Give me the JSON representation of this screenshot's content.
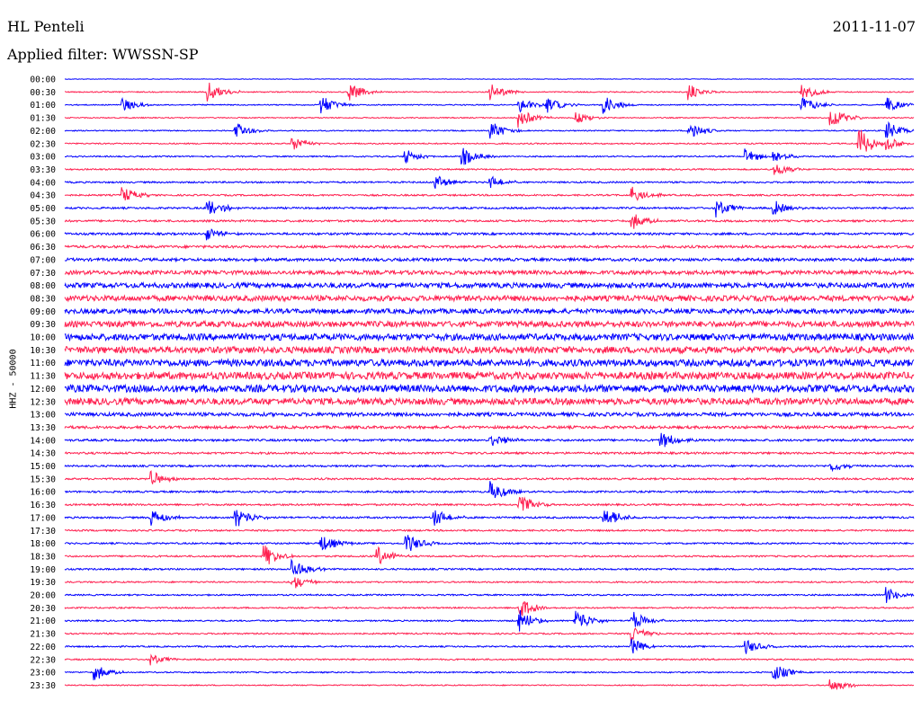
{
  "header": {
    "station": "HL Penteli",
    "date": "2011-11-07",
    "filter_label": "Applied filter:",
    "filter_value": "WWSSN-SP"
  },
  "chart_data": {
    "type": "line",
    "ylabel": "HHZ - 50000",
    "colors": [
      "#0000ff",
      "#ff1f4f"
    ],
    "rows": [
      "00:00",
      "00:30",
      "01:00",
      "01:30",
      "02:00",
      "02:30",
      "03:00",
      "03:30",
      "04:00",
      "04:30",
      "05:00",
      "05:30",
      "06:00",
      "06:30",
      "07:00",
      "07:30",
      "08:00",
      "08:30",
      "09:00",
      "09:30",
      "10:00",
      "10:30",
      "11:00",
      "11:30",
      "12:00",
      "12:30",
      "13:00",
      "13:30",
      "14:00",
      "14:30",
      "15:00",
      "15:30",
      "16:00",
      "16:30",
      "17:00",
      "17:30",
      "18:00",
      "18:30",
      "19:00",
      "19:30",
      "20:00",
      "20:30",
      "21:00",
      "21:30",
      "22:00",
      "22:30",
      "23:00",
      "23:30"
    ],
    "noise_level": [
      0.3,
      0.6,
      0.6,
      0.6,
      0.6,
      0.7,
      0.7,
      0.8,
      0.9,
      0.9,
      1.0,
      1.1,
      1.2,
      1.4,
      1.6,
      2.2,
      2.8,
      3.0,
      2.6,
      3.2,
      3.6,
      3.6,
      3.8,
      4.0,
      4.0,
      3.6,
      2.0,
      1.5,
      1.2,
      1.1,
      1.0,
      1.0,
      1.0,
      1.0,
      1.0,
      0.9,
      0.9,
      0.9,
      0.9,
      0.8,
      0.8,
      0.8,
      0.8,
      0.8,
      0.8,
      0.8,
      0.7,
      0.6
    ],
    "events": [
      {
        "row": 1,
        "minute": 5,
        "amp": 14
      },
      {
        "row": 2,
        "minute": 2,
        "amp": 8
      },
      {
        "row": 2,
        "minute": 17,
        "amp": 10
      },
      {
        "row": 2,
        "minute": 9,
        "amp": 12
      },
      {
        "row": 4,
        "minute": 15,
        "amp": 12
      },
      {
        "row": 1,
        "minute": 15,
        "amp": 10
      },
      {
        "row": 2,
        "minute": 16,
        "amp": 10
      },
      {
        "row": 3,
        "minute": 16,
        "amp": 12
      },
      {
        "row": 6,
        "minute": 12,
        "amp": 10
      },
      {
        "row": 3,
        "minute": 27,
        "amp": 14
      },
      {
        "row": 5,
        "minute": 28,
        "amp": 12
      },
      {
        "row": 6,
        "minute": 14,
        "amp": 12
      },
      {
        "row": 9,
        "minute": 20,
        "amp": 10
      },
      {
        "row": 3,
        "minute": 18,
        "amp": 8
      },
      {
        "row": 2,
        "minute": 29,
        "amp": 10
      },
      {
        "row": 6,
        "minute": 24,
        "amp": 10
      },
      {
        "row": 1,
        "minute": 10,
        "amp": 12
      },
      {
        "row": 4,
        "minute": 6,
        "amp": 10
      },
      {
        "row": 10,
        "minute": 5,
        "amp": 12
      },
      {
        "row": 8,
        "minute": 13,
        "amp": 10
      },
      {
        "row": 11,
        "minute": 20,
        "amp": 10
      },
      {
        "row": 10,
        "minute": 23,
        "amp": 12
      },
      {
        "row": 6,
        "minute": 25,
        "amp": 8
      },
      {
        "row": 5,
        "minute": 8,
        "amp": 10
      },
      {
        "row": 10,
        "minute": 25,
        "amp": 10
      },
      {
        "row": 2,
        "minute": 19,
        "amp": 12
      },
      {
        "row": 9,
        "minute": 2,
        "amp": 10
      },
      {
        "row": 2,
        "minute": 30,
        "amp": 12
      },
      {
        "row": 4,
        "minute": 29,
        "amp": 12
      },
      {
        "row": 4,
        "minute": 22,
        "amp": 12
      },
      {
        "row": 12,
        "minute": 5,
        "amp": 8
      },
      {
        "row": 8,
        "minute": 15,
        "amp": 8
      },
      {
        "row": 5,
        "minute": 29,
        "amp": 10
      },
      {
        "row": 28,
        "minute": 21,
        "amp": 12
      },
      {
        "row": 28,
        "minute": 15,
        "amp": 10
      },
      {
        "row": 30,
        "minute": 27,
        "amp": 8
      },
      {
        "row": 32,
        "minute": 15,
        "amp": 14
      },
      {
        "row": 34,
        "minute": 3,
        "amp": 12
      },
      {
        "row": 34,
        "minute": 13,
        "amp": 12
      },
      {
        "row": 33,
        "minute": 16,
        "amp": 14
      },
      {
        "row": 34,
        "minute": 19,
        "amp": 14
      },
      {
        "row": 34,
        "minute": 6,
        "amp": 14
      },
      {
        "row": 31,
        "minute": 3,
        "amp": 10
      },
      {
        "row": 36,
        "minute": 9,
        "amp": 12
      },
      {
        "row": 37,
        "minute": 11,
        "amp": 12
      },
      {
        "row": 38,
        "minute": 8,
        "amp": 14
      },
      {
        "row": 37,
        "minute": 7,
        "amp": 14
      },
      {
        "row": 36,
        "minute": 12,
        "amp": 14
      },
      {
        "row": 39,
        "minute": 8,
        "amp": 10
      },
      {
        "row": 42,
        "minute": 16,
        "amp": 14
      },
      {
        "row": 41,
        "minute": 16,
        "amp": 14
      },
      {
        "row": 42,
        "minute": 18,
        "amp": 16
      },
      {
        "row": 43,
        "minute": 20,
        "amp": 12
      },
      {
        "row": 42,
        "minute": 20,
        "amp": 12
      },
      {
        "row": 45,
        "minute": 3,
        "amp": 8
      },
      {
        "row": 46,
        "minute": 1,
        "amp": 10
      },
      {
        "row": 47,
        "minute": 27,
        "amp": 10
      },
      {
        "row": 46,
        "minute": 25,
        "amp": 12
      },
      {
        "row": 40,
        "minute": 29,
        "amp": 10
      },
      {
        "row": 44,
        "minute": 20,
        "amp": 10
      },
      {
        "row": 44,
        "minute": 24,
        "amp": 10
      },
      {
        "row": 1,
        "minute": 26,
        "amp": 10
      },
      {
        "row": 5,
        "minute": 28,
        "amp": 14
      },
      {
        "row": 1,
        "minute": 22,
        "amp": 10
      },
      {
        "row": 2,
        "minute": 26,
        "amp": 10
      },
      {
        "row": 7,
        "minute": 25,
        "amp": 10
      }
    ]
  }
}
